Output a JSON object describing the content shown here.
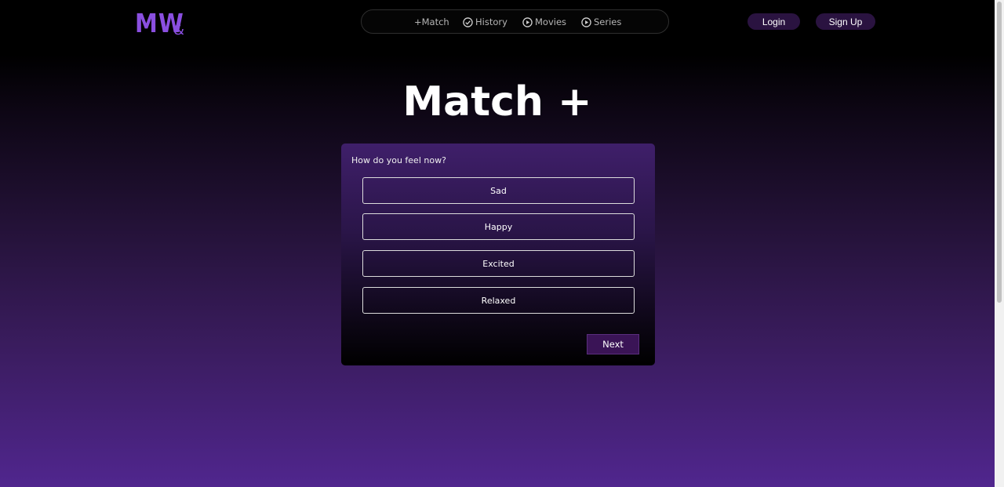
{
  "header": {
    "logo_main": "MW",
    "logo_suffix": "&",
    "nav": [
      {
        "label": "+Match",
        "icon": "plus-icon"
      },
      {
        "label": "History",
        "icon": "check-circle-icon"
      },
      {
        "label": "Movies",
        "icon": "play-circle-icon"
      },
      {
        "label": "Series",
        "icon": "play-circle-icon"
      }
    ],
    "login_label": "Login",
    "signup_label": "Sign Up"
  },
  "main": {
    "title": "Match +",
    "question": "How do you feel now?",
    "options": [
      "Sad",
      "Happy",
      "Excited",
      "Relaxed"
    ],
    "next_label": "Next"
  },
  "colors": {
    "accent": "#8a4fe0",
    "button_bg": "#2a1340",
    "gradient_bottom": "#50268e"
  }
}
